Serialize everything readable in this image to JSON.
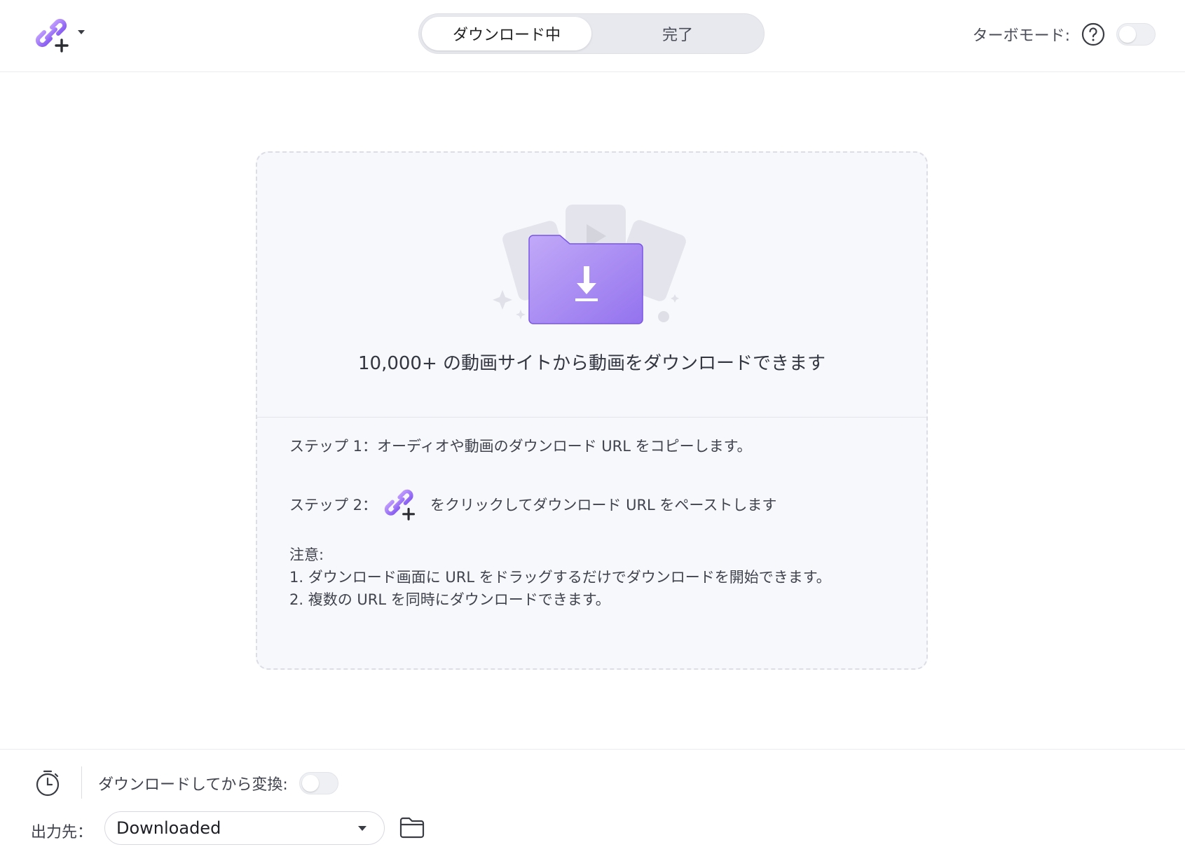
{
  "header": {
    "add_url_icon": "link-plus-icon",
    "tabs": [
      {
        "label": "ダウンロード中",
        "active": true
      },
      {
        "label": "完了",
        "active": false
      }
    ],
    "turbo": {
      "label": "ターボモード:",
      "enabled": false
    }
  },
  "main": {
    "headline": "10,000+ の動画サイトから動画をダウンロードできます",
    "step1": "ステップ 1：オーディオや動画のダウンロード URL をコピーします。",
    "step2_prefix": "ステップ 2：",
    "step2_suffix": "をクリックしてダウンロード URL をペーストします",
    "note_title": "注意:",
    "note_1": "1. ダウンロード画面に URL をドラッグするだけでダウンロードを開始できます。",
    "note_2": "2. 複数の URL を同時にダウンロードできます。"
  },
  "footer": {
    "convert_label": "ダウンロードしてから変換:",
    "convert_enabled": false,
    "output_label": "出力先：",
    "output_value": "Downloaded"
  },
  "colors": {
    "accent": "#8b63f0",
    "accent_light": "#b89cf7",
    "folder": "#a584f3"
  }
}
